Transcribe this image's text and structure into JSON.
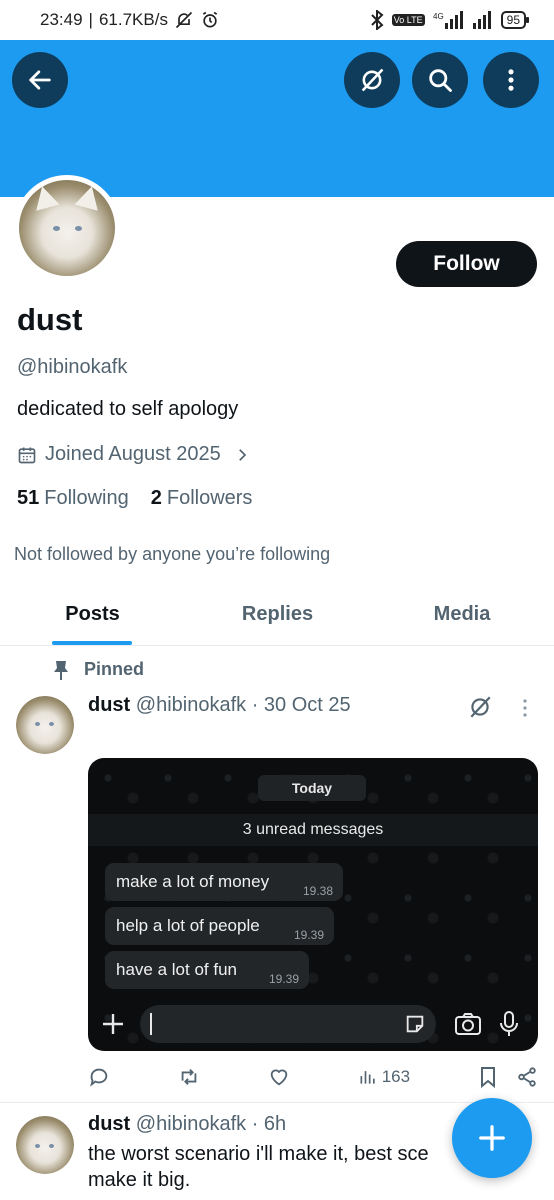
{
  "status_bar": {
    "time": "23:49",
    "speed": "61.7KB/s",
    "battery": "95",
    "volte": "Vo LTE",
    "network": "4G"
  },
  "header": {
    "back_icon": "arrow-left-icon",
    "grok_icon": "grok-icon",
    "search_icon": "search-icon",
    "more_icon": "more-vertical-icon",
    "banner_color": "#1d9bf0"
  },
  "profile": {
    "follow_label": "Follow",
    "name": "dust",
    "handle": "@hibinokafk",
    "bio": "dedicated to self apology",
    "joined": "Joined August 2025",
    "following_count": "51",
    "following_label": "Following",
    "followers_count": "2",
    "followers_label": "Followers",
    "not_followed": "Not followed by anyone you’re following"
  },
  "tabs": [
    {
      "label": "Posts",
      "active": true
    },
    {
      "label": "Replies",
      "active": false
    },
    {
      "label": "Media",
      "active": false
    }
  ],
  "pinned_post": {
    "pinned_label": "Pinned",
    "name": "dust",
    "handle_date": "@hibinokafk · 30 Oct 25",
    "image": {
      "today": "Today",
      "unread": "3 unread messages",
      "messages": [
        {
          "text": "make a lot of money",
          "time": "19.38"
        },
        {
          "text": "help a lot of people",
          "time": "19.39"
        },
        {
          "text": "have a lot of fun",
          "time": "19.39"
        }
      ]
    },
    "views": "163"
  },
  "second_post": {
    "name": "dust",
    "handle_date": "@hibinokafk · 6h",
    "text": "the worst scenario i'll make it, best sce",
    "text_end": "l",
    "text_line2": "make it big."
  },
  "fab_icon": "plus-icon"
}
